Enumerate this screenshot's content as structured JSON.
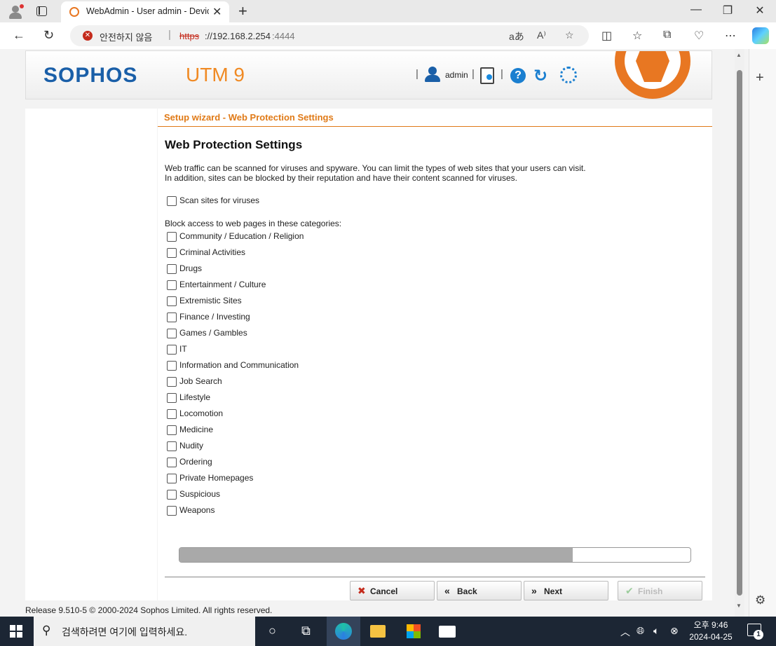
{
  "browser": {
    "tab_title": "WebAdmin - User admin - Device",
    "security_label": "안전하지 않음",
    "url_protocol": "https",
    "url_host": "://192.168.2.254",
    "url_port": ":4444",
    "read_aloud": "aあ"
  },
  "header": {
    "logo": "SOPHOS",
    "product": "UTM 9",
    "user": "admin"
  },
  "wizard": {
    "title": "Setup wizard - Web Protection Settings",
    "heading": "Web Protection Settings",
    "intro_line1": "Web traffic can be scanned for viruses and spyware. You can limit the types of web sites that your users can visit.",
    "intro_line2": "In addition, sites can be blocked by their reputation and have their content scanned for viruses.",
    "scan_label": "Scan sites for viruses",
    "block_label": "Block access to web pages in these categories:",
    "categories": [
      "Community / Education / Religion",
      "Criminal Activities",
      "Drugs",
      "Entertainment / Culture",
      "Extremistic Sites",
      "Finance / Investing",
      "Games / Gambles",
      "IT",
      "Information and Communication",
      "Job Search",
      "Lifestyle",
      "Locomotion",
      "Medicine",
      "Nudity",
      "Ordering",
      "Private Homepages",
      "Suspicious",
      "Weapons"
    ],
    "progress_fraction": 0.77,
    "buttons": {
      "cancel": "Cancel",
      "back": "Back",
      "next": "Next",
      "finish": "Finish"
    }
  },
  "release": "Release 9.510-5  © 2000-2024 Sophos Limited. All rights reserved.",
  "taskbar": {
    "search_placeholder": "검색하려면 여기에 입력하세요.",
    "time": "오후 9:46",
    "date": "2024-04-25",
    "notifications": "1"
  },
  "colors": {
    "accent_orange": "#e07a17",
    "sophos_blue": "#1a5fa8"
  }
}
